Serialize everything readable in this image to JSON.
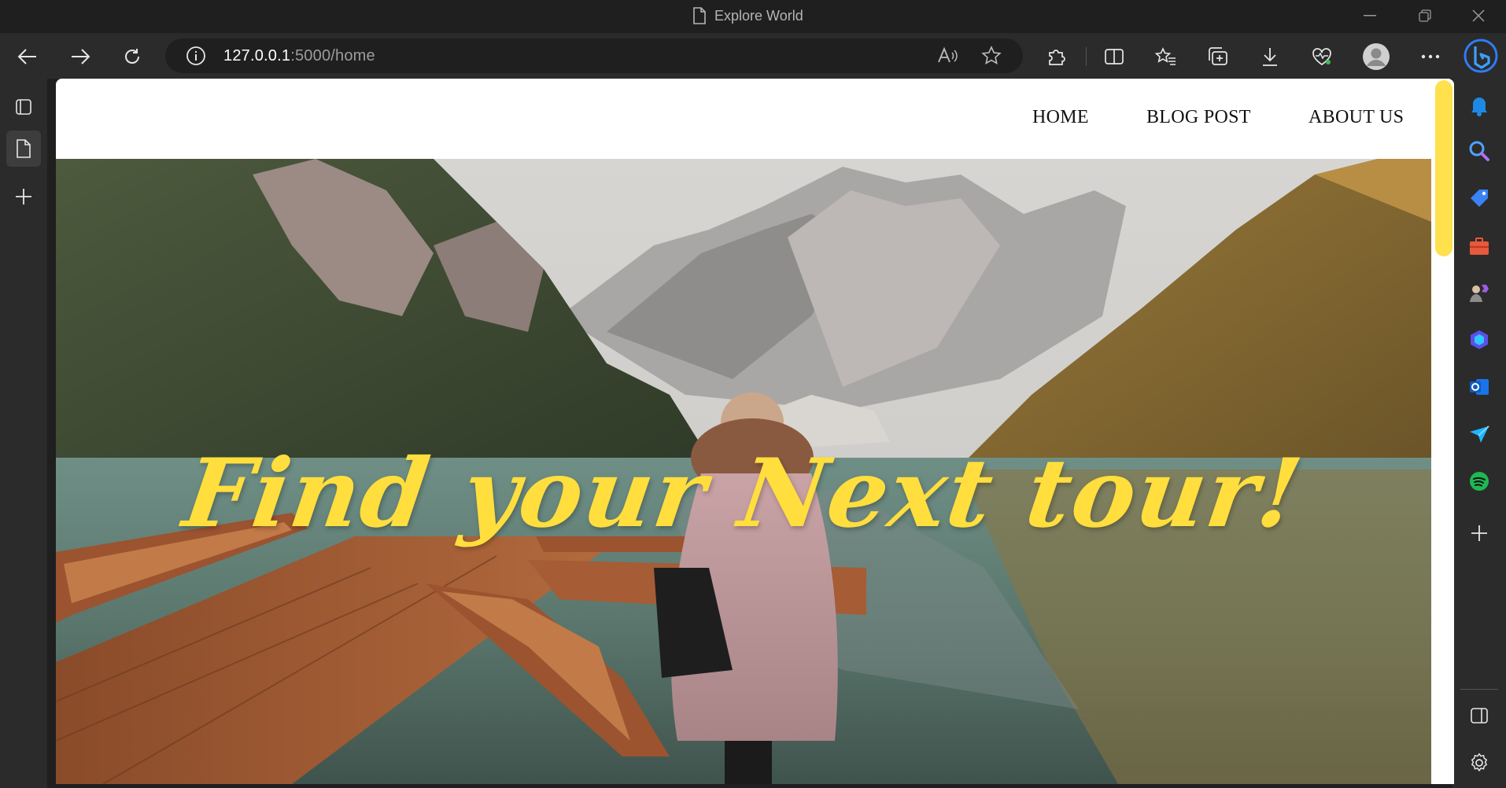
{
  "window": {
    "title": "Explore World",
    "minimize_glyph": "—",
    "restore_glyph": "❐",
    "close_glyph": "✕"
  },
  "browser": {
    "url_host": "127.0.0.1",
    "url_path": ":5000/home",
    "icons": [
      "back-icon",
      "forward-icon",
      "refresh-icon",
      "info-icon",
      "read-aloud-icon",
      "favorite-star-icon",
      "extensions-icon",
      "split-screen-icon",
      "favorites-icon",
      "collections-icon",
      "downloads-icon",
      "browser-essentials-icon",
      "profile-avatar-icon",
      "more-icon",
      "bing-copilot-icon"
    ]
  },
  "left_sidebar": {
    "icons": [
      "tab-actions-icon",
      "page-tab-icon",
      "new-tab-plus-icon"
    ]
  },
  "right_sidebar": {
    "icons": [
      "bell-icon",
      "search-icon",
      "shopping-tag-icon",
      "tools-briefcase-icon",
      "games-icon",
      "microsoft365-icon",
      "outlook-icon",
      "drop-send-icon",
      "spotify-icon",
      "add-plus-icon",
      "sidebar-toggle-icon",
      "settings-gear-icon"
    ]
  },
  "site": {
    "nav": [
      {
        "label": "HOME"
      },
      {
        "label": "BLOG POST"
      },
      {
        "label": "ABOUT US"
      }
    ],
    "hero": {
      "headline": "Find your Next tour!",
      "image": "mountain-lake-boats-photo"
    },
    "colors": {
      "accent": "#ffde3d",
      "scrollbar_thumb": "#ffe04d",
      "nav_text": "#111111"
    }
  }
}
